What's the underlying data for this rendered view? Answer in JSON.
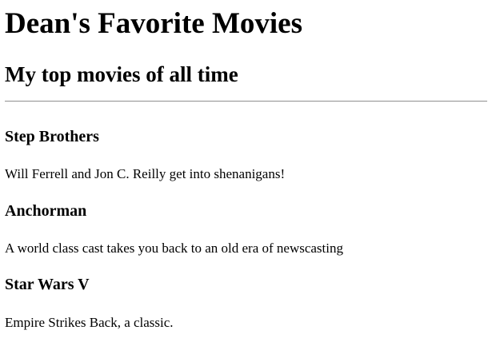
{
  "page": {
    "title": "Dean's Favorite Movies",
    "subtitle": "My top movies of all time"
  },
  "movies": [
    {
      "title": "Step Brothers",
      "description": "Will Ferrell and Jon C. Reilly get into shenanigans!"
    },
    {
      "title": "Anchorman",
      "description": "A world class cast takes you back to an old era of newscasting"
    },
    {
      "title": "Star Wars V",
      "description": "Empire Strikes Back, a classic."
    }
  ]
}
